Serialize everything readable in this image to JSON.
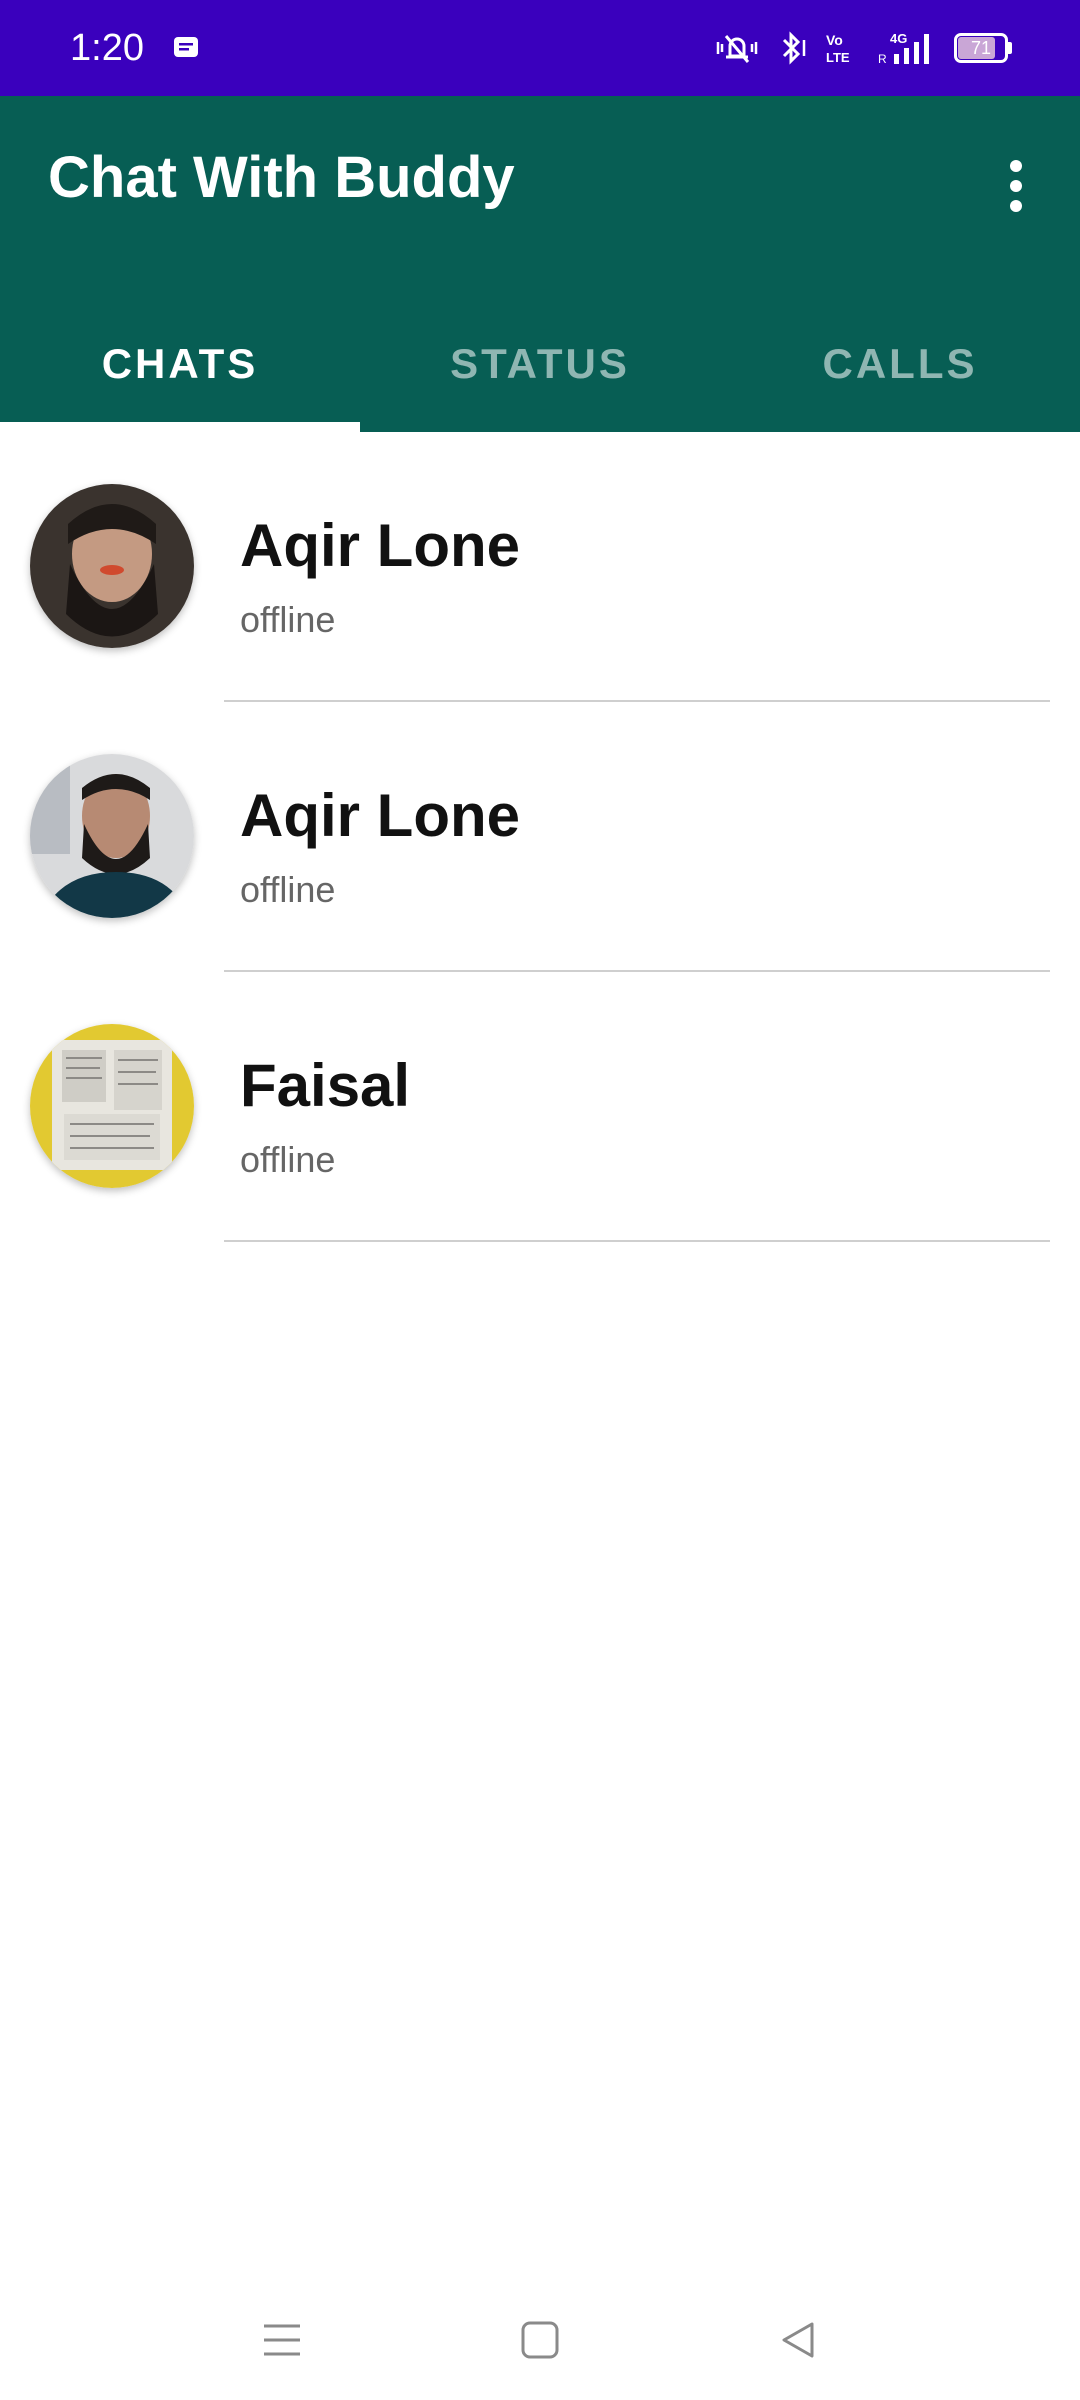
{
  "status_bar": {
    "time": "1:20",
    "battery": "71",
    "network": "4G",
    "icons": [
      "message-icon",
      "vibrate-mute-icon",
      "bluetooth-icon",
      "volte-icon",
      "signal-icon",
      "battery-icon"
    ]
  },
  "app_bar": {
    "title": "Chat With Buddy",
    "menu_icon": "more-vert-icon"
  },
  "tabs": [
    {
      "label": "CHATS",
      "active": true
    },
    {
      "label": "STATUS",
      "active": false
    },
    {
      "label": "CALLS",
      "active": false
    }
  ],
  "chats": [
    {
      "name": "Aqir Lone",
      "status": "offline"
    },
    {
      "name": "Aqir Lone",
      "status": "offline"
    },
    {
      "name": "Faisal",
      "status": "offline"
    }
  ],
  "nav_bar": {
    "icons": [
      "recents-menu-icon",
      "home-icon",
      "back-icon"
    ]
  },
  "colors": {
    "status_bar": "#3a00bd",
    "app_bar": "#075e54"
  }
}
